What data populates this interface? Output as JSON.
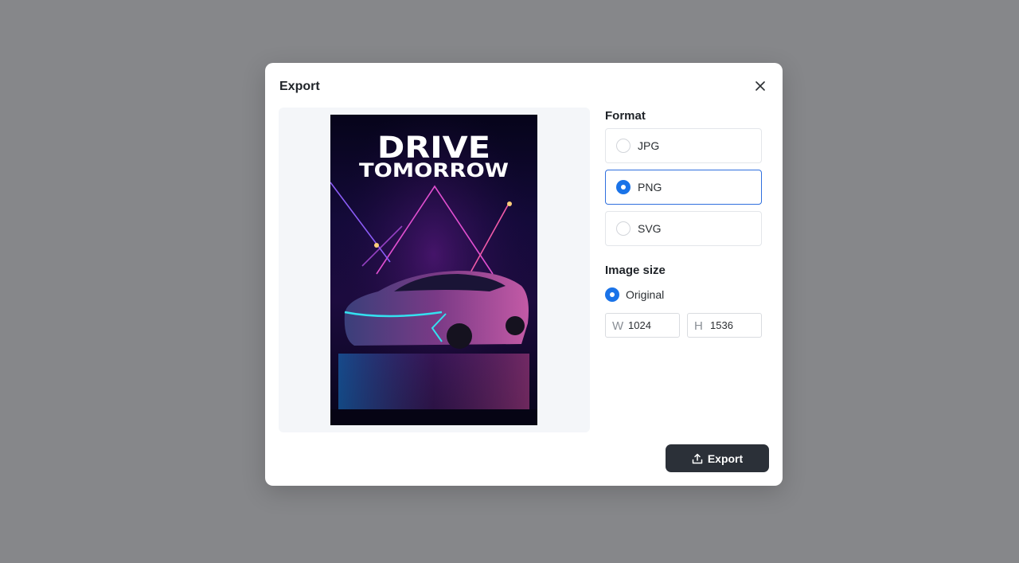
{
  "dialog": {
    "title": "Export",
    "close_icon": "close-icon",
    "export_label": "Export",
    "export_icon": "upload-icon"
  },
  "preview": {
    "poster_line1": "DRIVE",
    "poster_line2": "TOMORROW"
  },
  "format": {
    "label": "Format",
    "options": [
      {
        "label": "JPG",
        "selected": false
      },
      {
        "label": "PNG",
        "selected": true
      },
      {
        "label": "SVG",
        "selected": false
      }
    ]
  },
  "image_size": {
    "label": "Image size",
    "original_label": "Original",
    "original_selected": true,
    "width_prefix": "W",
    "height_prefix": "H",
    "width": "1024",
    "height": "1536"
  },
  "colors": {
    "backdrop": "#86878a",
    "accent": "#1a73e8",
    "button": "#2b3038"
  }
}
